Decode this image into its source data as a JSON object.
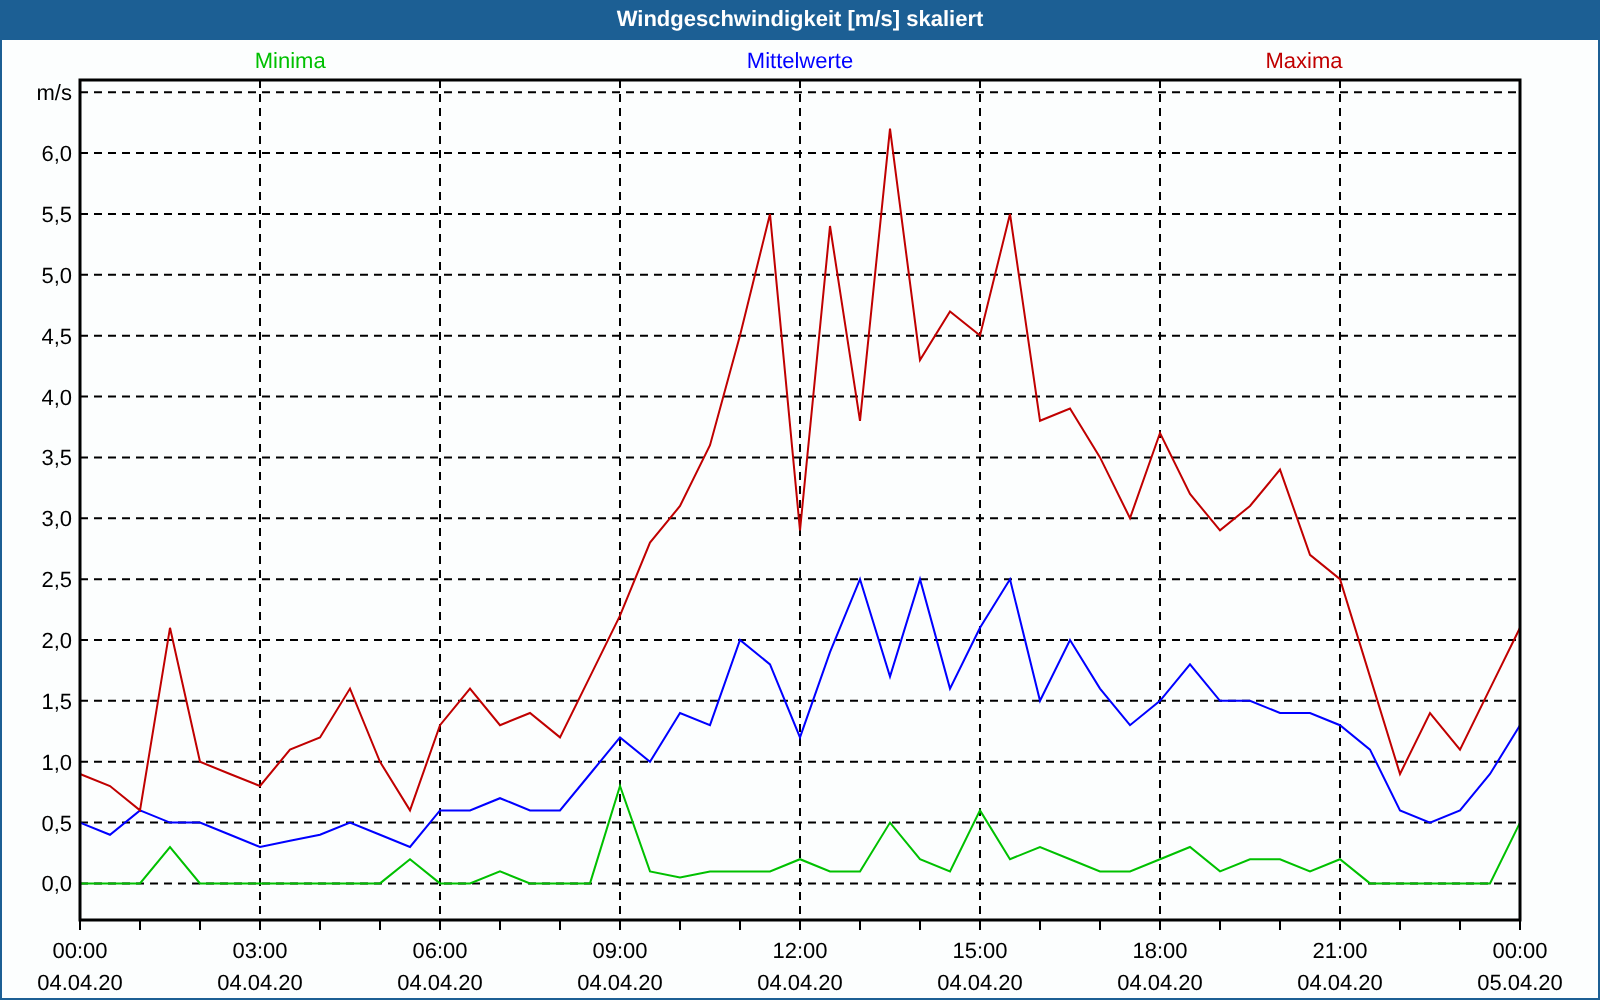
{
  "window": {
    "title": "Windgeschwindigkeit [m/s] skaliert"
  },
  "chart": {
    "chart_data": {
      "type": "line",
      "grid": true,
      "ylabel": "m/s",
      "xlim": [
        0,
        24
      ],
      "ylim": [
        -0.3,
        6.6
      ],
      "x": [
        0,
        0.5,
        1,
        1.5,
        2,
        2.5,
        3,
        3.5,
        4,
        4.5,
        5,
        5.5,
        6,
        6.5,
        7,
        7.5,
        8,
        8.5,
        9,
        9.5,
        10,
        10.5,
        11,
        11.5,
        12,
        12.5,
        13,
        13.5,
        14,
        14.5,
        15,
        15.5,
        16,
        16.5,
        17,
        17.5,
        18,
        18.5,
        19,
        19.5,
        20,
        20.5,
        21,
        21.5,
        22,
        22.5,
        23,
        23.5,
        24
      ],
      "series": [
        {
          "name": "Minima",
          "color": "#00c000",
          "values": [
            0,
            0,
            0,
            0.3,
            0,
            0,
            0,
            0,
            0,
            0,
            0,
            0.2,
            0,
            0,
            0.1,
            0,
            0,
            0,
            0.8,
            0.1,
            0.05,
            0.1,
            0.1,
            0.1,
            0.2,
            0.1,
            0.1,
            0.5,
            0.2,
            0.1,
            0.6,
            0.2,
            0.3,
            0.2,
            0.1,
            0.1,
            0.2,
            0.3,
            0.1,
            0.2,
            0.2,
            0.1,
            0.2,
            0,
            0,
            0,
            0,
            0,
            0.5
          ]
        },
        {
          "name": "Mittelwerte",
          "color": "#0000ff",
          "values": [
            0.5,
            0.4,
            0.6,
            0.5,
            0.5,
            0.4,
            0.3,
            0.35,
            0.4,
            0.5,
            0.4,
            0.3,
            0.6,
            0.6,
            0.7,
            0.6,
            0.6,
            0.9,
            1.2,
            1.0,
            1.4,
            1.3,
            2.0,
            1.8,
            1.2,
            1.9,
            2.5,
            1.7,
            2.5,
            1.6,
            2.1,
            2.5,
            1.5,
            2.0,
            1.6,
            1.3,
            1.5,
            1.8,
            1.5,
            1.5,
            1.4,
            1.4,
            1.3,
            1.1,
            0.6,
            0.5,
            0.6,
            0.9,
            1.3
          ]
        },
        {
          "name": "Maxima",
          "color": "#c00000",
          "values": [
            0.9,
            0.8,
            0.6,
            2.1,
            1.0,
            0.9,
            0.8,
            1.1,
            1.2,
            1.6,
            1.0,
            0.6,
            1.3,
            1.6,
            1.3,
            1.4,
            1.2,
            1.7,
            2.2,
            2.8,
            3.1,
            3.6,
            4.5,
            5.5,
            2.9,
            5.4,
            3.8,
            6.2,
            4.3,
            4.7,
            4.5,
            5.5,
            3.8,
            3.9,
            3.5,
            3.0,
            3.7,
            3.2,
            2.9,
            3.1,
            3.4,
            2.7,
            2.5,
            1.7,
            0.9,
            1.4,
            1.1,
            1.6,
            2.1
          ]
        }
      ],
      "xticks": [
        {
          "value": 0,
          "label": "00:00"
        },
        {
          "value": 3,
          "label": "03:00"
        },
        {
          "value": 6,
          "label": "06:00"
        },
        {
          "value": 9,
          "label": "09:00"
        },
        {
          "value": 12,
          "label": "12:00"
        },
        {
          "value": 15,
          "label": "15:00"
        },
        {
          "value": 18,
          "label": "18:00"
        },
        {
          "value": 21,
          "label": "21:00"
        },
        {
          "value": 24,
          "label": "00:00"
        }
      ],
      "yticks": [
        {
          "value": 0,
          "label": "0,0"
        },
        {
          "value": 0.5,
          "label": "0,5"
        },
        {
          "value": 1,
          "label": "1,0"
        },
        {
          "value": 1.5,
          "label": "1,5"
        },
        {
          "value": 2,
          "label": "2,0"
        },
        {
          "value": 2.5,
          "label": "2,5"
        },
        {
          "value": 3,
          "label": "3,0"
        },
        {
          "value": 3.5,
          "label": "3,5"
        },
        {
          "value": 4,
          "label": "4,0"
        },
        {
          "value": 4.5,
          "label": "4,5"
        },
        {
          "value": 5,
          "label": "5,0"
        },
        {
          "value": 5.5,
          "label": "5,5"
        },
        {
          "value": 6,
          "label": "6,0"
        }
      ]
    },
    "xtick_dates": [
      "04.04.20",
      "04.04.20",
      "04.04.20",
      "04.04.20",
      "04.04.20",
      "04.04.20",
      "04.04.20",
      "04.04.20",
      "05.04.20"
    ]
  }
}
